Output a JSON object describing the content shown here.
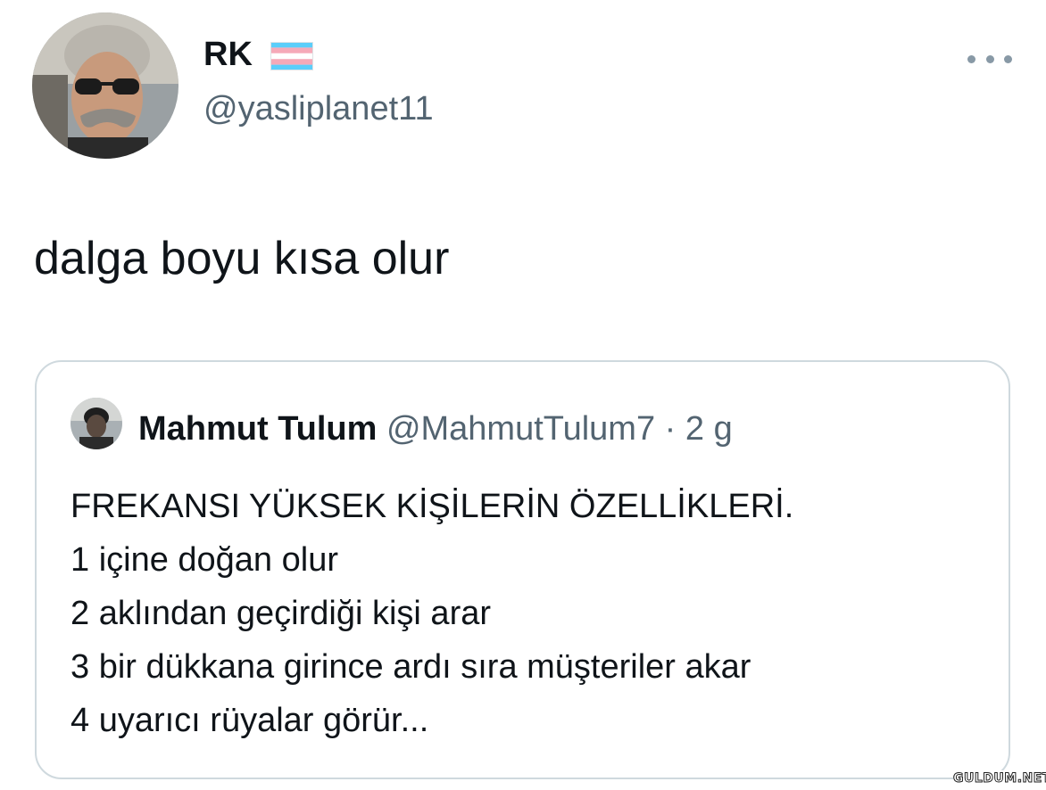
{
  "author": {
    "display_name": "RK",
    "flag_icon": "transgender-flag-icon",
    "handle": "@yasliplanet11"
  },
  "more_icon": "more-dots-icon",
  "tweet": {
    "text": "dalga boyu kısa olur"
  },
  "quoted_tweet": {
    "display_name": "Mahmut Tulum",
    "handle": "@MahmutTulum7",
    "separator": "·",
    "time": "2 g",
    "lines": [
      "FREKANSI YÜKSEK KİŞİLERİN ÖZELLİKLERİ.",
      "1 içine doğan olur",
      "2 aklından geçirdiği kişi arar",
      "3 bir dükkana girince ardı sıra müşteriler akar",
      "4 uyarıcı rüyalar görür..."
    ]
  },
  "watermark": "GULDUM.NET",
  "colors": {
    "text_primary": "#0f1419",
    "text_secondary": "#536471",
    "card_border": "#cfd9de",
    "flag_blue": "#5bcefa",
    "flag_pink": "#f5a9b8"
  }
}
